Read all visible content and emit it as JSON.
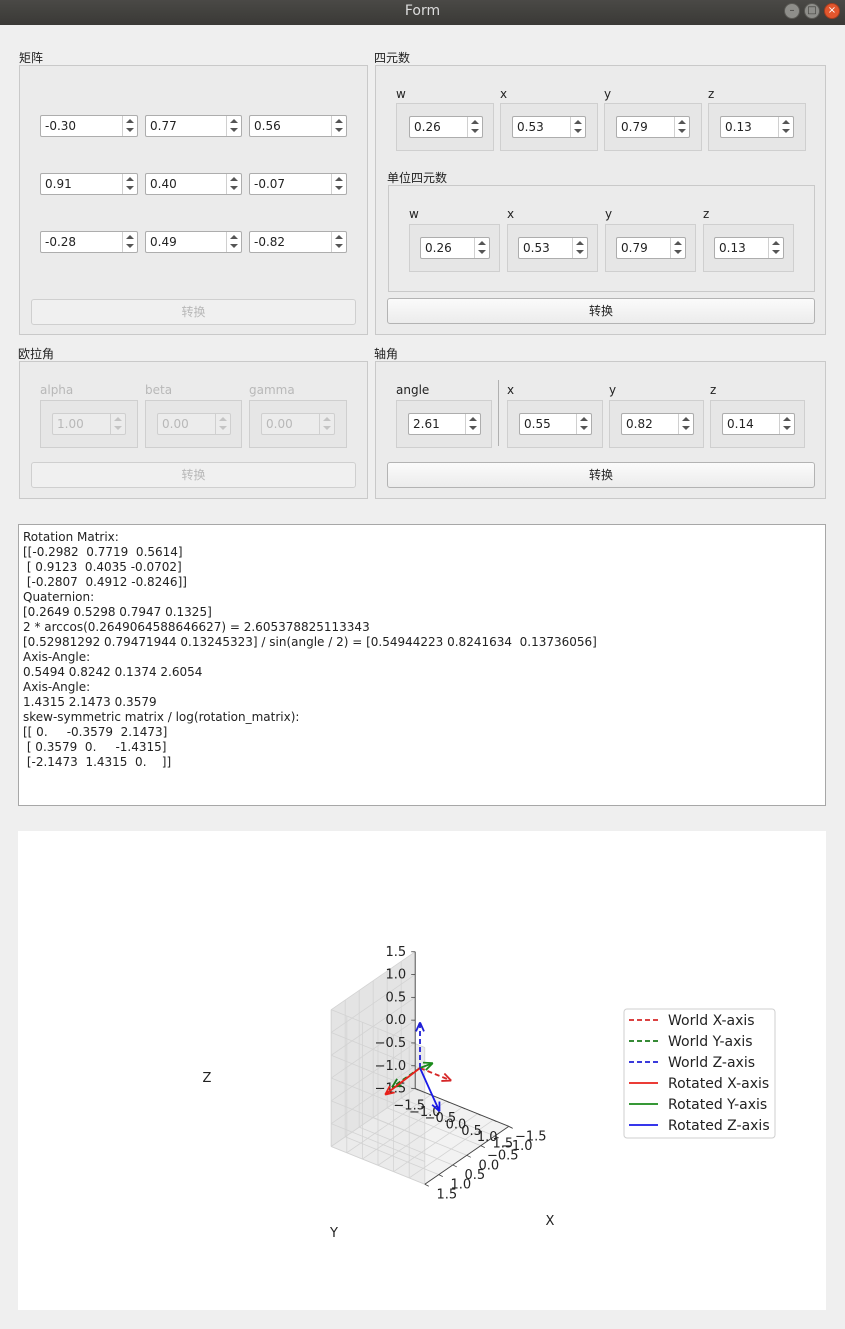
{
  "window": {
    "title": "Form",
    "minimize": "–",
    "maximize": "□",
    "close": "×"
  },
  "matrix": {
    "title": "矩阵",
    "rows": [
      [
        "-0.30",
        "0.77",
        "0.56"
      ],
      [
        "0.91",
        "0.40",
        "-0.07"
      ],
      [
        "-0.28",
        "0.49",
        "-0.82"
      ]
    ],
    "convert_label": "转换"
  },
  "quaternion": {
    "title": "四元数",
    "labels": [
      "w",
      "x",
      "y",
      "z"
    ],
    "values": [
      "0.26",
      "0.53",
      "0.79",
      "0.13"
    ],
    "unit": {
      "title": "单位四元数",
      "labels": [
        "w",
        "x",
        "y",
        "z"
      ],
      "values": [
        "0.26",
        "0.53",
        "0.79",
        "0.13"
      ]
    },
    "convert_label": "转换"
  },
  "euler": {
    "title": "欧拉角",
    "labels": [
      "alpha",
      "beta",
      "gamma"
    ],
    "values": [
      "1.00",
      "0.00",
      "0.00"
    ],
    "convert_label": "转换"
  },
  "axis_angle": {
    "title": "轴角",
    "angle_label": "angle",
    "angle_value": "2.61",
    "labels": [
      "x",
      "y",
      "z"
    ],
    "values": [
      "0.55",
      "0.82",
      "0.14"
    ],
    "convert_label": "转换"
  },
  "console": {
    "lines": [
      "Rotation Matrix:",
      "[[-0.2982  0.7719  0.5614]",
      " [ 0.9123  0.4035 -0.0702]",
      " [-0.2807  0.4912 -0.8246]]",
      "Quaternion:",
      "[0.2649 0.5298 0.7947 0.1325]",
      "2 * arccos(0.2649064588646627) = 2.605378825113343",
      "[0.52981292 0.79471944 0.13245323] / sin(angle / 2) = [0.54944223 0.8241634  0.13736056]",
      "Axis-Angle:",
      "0.5494 0.8242 0.1374 2.6054",
      "Axis-Angle:",
      "1.4315 2.1473 0.3579",
      "skew-symmetric matrix / log(rotation_matrix):",
      "[[ 0.     -0.3579  2.1473]",
      " [ 0.3579  0.     -1.4315]",
      " [-2.1473  1.4315  0.    ]]"
    ]
  },
  "chart_data": {
    "type": "line",
    "projection": "3d",
    "xlabel": "X",
    "ylabel": "Y",
    "zlabel": "Z",
    "xlim": [
      -1.5,
      1.5
    ],
    "ylim": [
      -1.5,
      1.5
    ],
    "zlim": [
      -1.5,
      1.5
    ],
    "tick_labels": [
      "−1.5",
      "−1.0",
      "−0.5",
      "0.0",
      "0.5",
      "1.0",
      "1.5"
    ],
    "grid": true,
    "legend_position": "right",
    "series": [
      {
        "name": "World X-axis",
        "style": "dashed",
        "color": "#d62728",
        "x": [
          0,
          1
        ],
        "y": [
          0,
          0
        ],
        "z": [
          0,
          0
        ]
      },
      {
        "name": "World Y-axis",
        "style": "dashed",
        "color": "#1a7a1a",
        "x": [
          0,
          0
        ],
        "y": [
          0,
          1
        ],
        "z": [
          0,
          0
        ]
      },
      {
        "name": "World Z-axis",
        "style": "dashed",
        "color": "#1f1fd6",
        "x": [
          0,
          0
        ],
        "y": [
          0,
          0
        ],
        "z": [
          0,
          1
        ]
      },
      {
        "name": "Rotated X-axis",
        "style": "solid",
        "color": "#e8201a",
        "x": [
          0,
          -0.2982
        ],
        "y": [
          0,
          0.9123
        ],
        "z": [
          0,
          -0.2807
        ]
      },
      {
        "name": "Rotated Y-axis",
        "style": "solid",
        "color": "#1a8a1a",
        "x": [
          0,
          0.7719
        ],
        "y": [
          0,
          0.4035
        ],
        "z": [
          0,
          0.4912
        ]
      },
      {
        "name": "Rotated Z-axis",
        "style": "solid",
        "color": "#1a1ae8",
        "x": [
          0,
          0.5614
        ],
        "y": [
          0,
          -0.0702
        ],
        "z": [
          0,
          -0.8246
        ]
      }
    ]
  }
}
